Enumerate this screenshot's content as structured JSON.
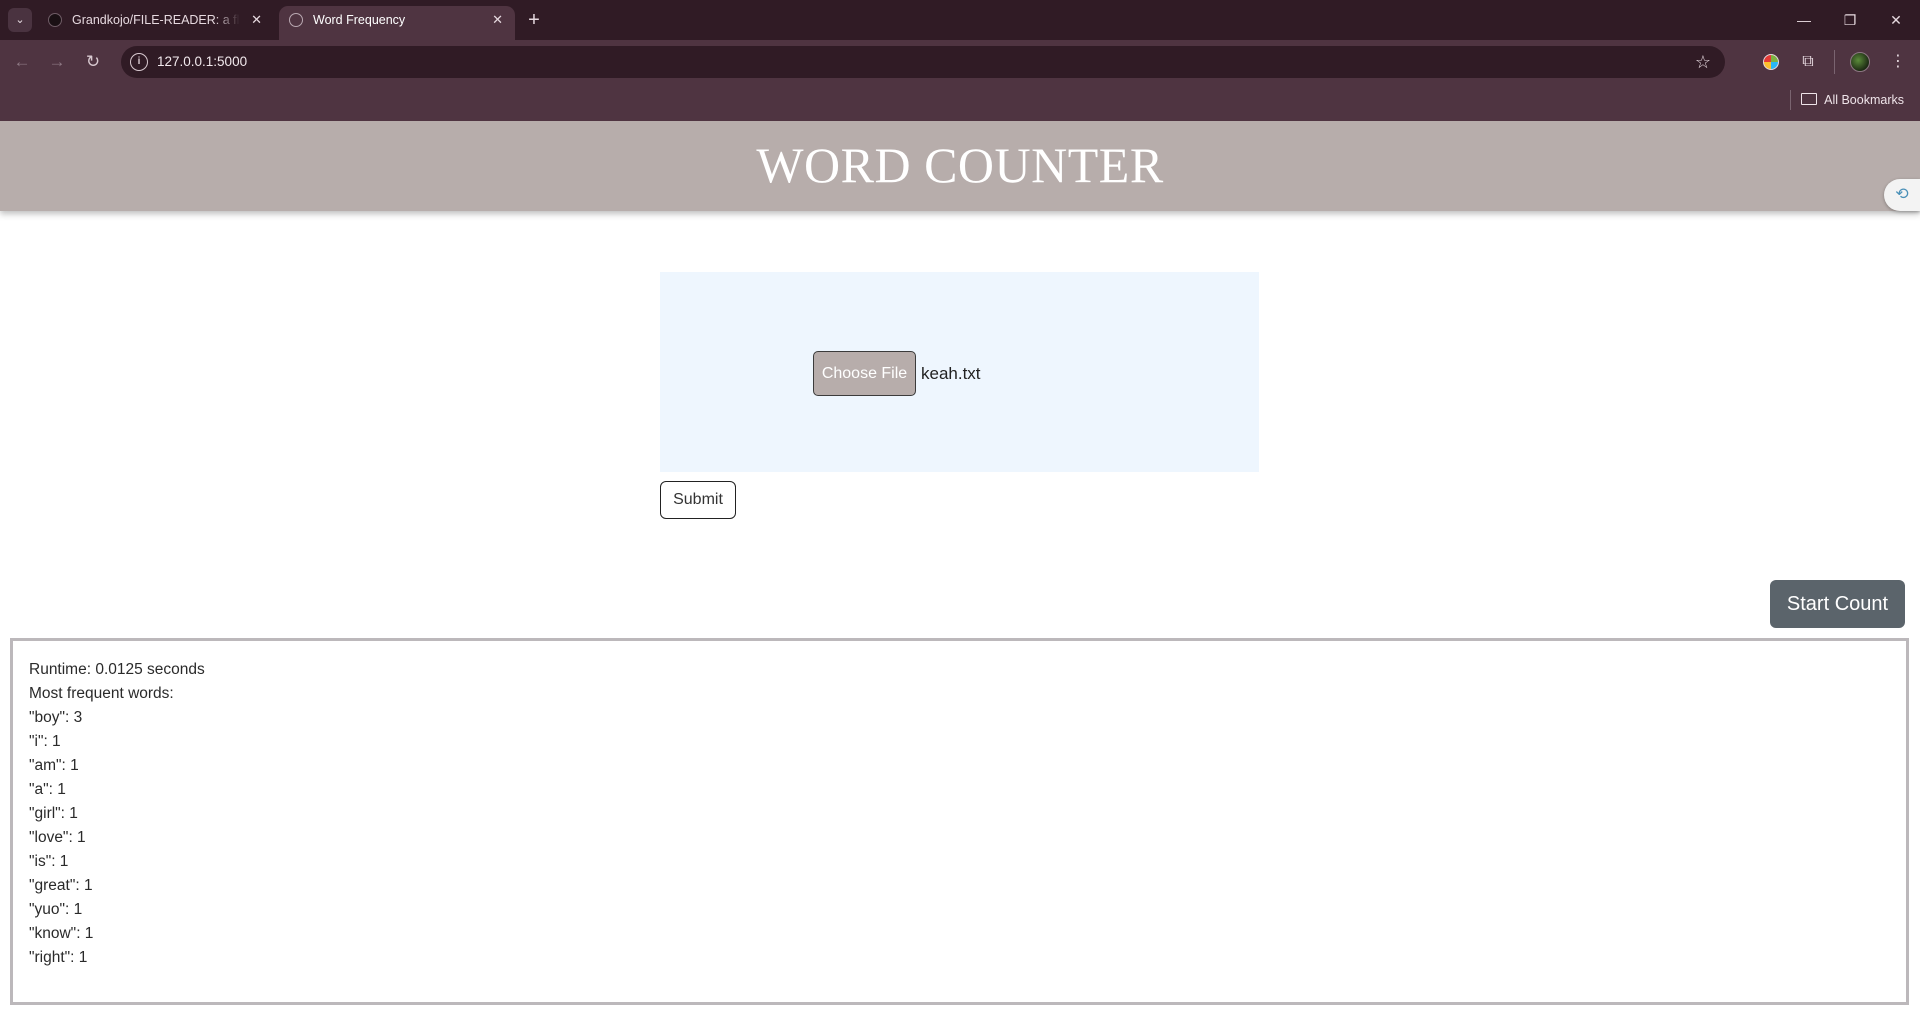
{
  "browser": {
    "tabs": [
      {
        "title": "Grandkojo/FILE-READER: a flask",
        "close": "✕"
      },
      {
        "title": "Word Frequency",
        "close": "✕"
      }
    ],
    "new_tab": "+",
    "tab_list": "⌄",
    "window_controls": {
      "minimize": "—",
      "restore": "❐",
      "close": "✕"
    },
    "nav": {
      "back": "←",
      "forward": "→",
      "reload": "↻"
    },
    "site_info": "i",
    "url": "127.0.0.1:5000",
    "star": "☆",
    "extensions": "⧉",
    "menu": "⋮",
    "bookmarks_label": "All Bookmarks"
  },
  "page": {
    "title": "WORD COUNTER",
    "choose_file_label": "Choose File",
    "file_name": "keah.txt",
    "submit_label": "Submit",
    "start_count_label": "Start Count",
    "widget_icon": "⟲",
    "results": {
      "runtime": "Runtime: 0.0125 seconds",
      "heading": "Most frequent words:",
      "words": [
        "\"boy\": 3",
        "\"i\": 1",
        "\"am\": 1",
        "\"a\": 1",
        "\"girl\": 1",
        "\"love\": 1",
        "\"is\": 1",
        "\"great\": 1",
        "\"yuo\": 1",
        "\"know\": 1",
        "\"right\": 1"
      ]
    }
  },
  "colors": {
    "tab_strip": "#301b25",
    "toolbar": "#4f3441",
    "header_bg": "#b7adab",
    "upload_bg": "#eef6fe",
    "start_btn": "#5b646b"
  }
}
